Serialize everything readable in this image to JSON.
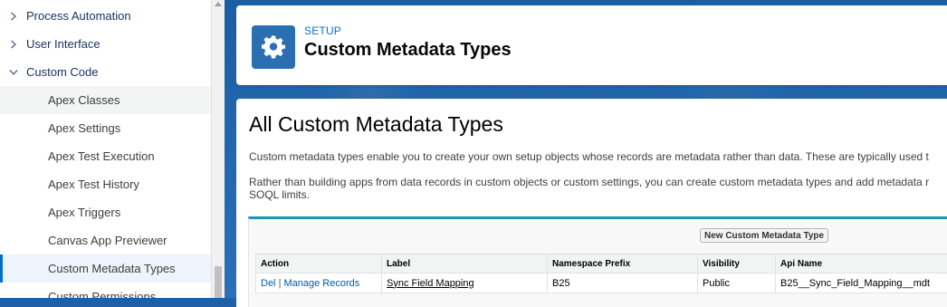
{
  "sidebar": {
    "items": [
      {
        "label": "Process Automation",
        "level": 1,
        "expanded": false
      },
      {
        "label": "User Interface",
        "level": 1,
        "expanded": false
      },
      {
        "label": "Custom Code",
        "level": 1,
        "expanded": true
      },
      {
        "label": "Apex Classes",
        "level": 2
      },
      {
        "label": "Apex Settings",
        "level": 2
      },
      {
        "label": "Apex Test Execution",
        "level": 2
      },
      {
        "label": "Apex Test History",
        "level": 2
      },
      {
        "label": "Apex Triggers",
        "level": 2
      },
      {
        "label": "Canvas App Previewer",
        "level": 2
      },
      {
        "label": "Custom Metadata Types",
        "level": 2,
        "selected": true
      },
      {
        "label": "Custom Permissions",
        "level": 2
      }
    ]
  },
  "header": {
    "eyebrow": "SETUP",
    "title": "Custom Metadata Types",
    "icon": "gear-icon"
  },
  "content": {
    "heading": "All Custom Metadata Types",
    "desc1": "Custom metadata types enable you to create your own setup objects whose records are metadata rather than data. These are typically used t",
    "desc2": "Rather than building apps from data records in custom objects or custom settings, you can create custom metadata types and add metadata r",
    "desc2b": "SOQL limits.",
    "new_button": "New Custom Metadata Type",
    "columns": [
      "Action",
      "Label",
      "Namespace Prefix",
      "Visibility",
      "Api Name"
    ],
    "rows": [
      {
        "action_del": "Del",
        "action_sep": "|",
        "action_manage": "Manage Records",
        "label": "Sync Field Mapping",
        "namespace": "B25",
        "visibility": "Public",
        "api_name": "B25__Sync_Field_Mapping__mdt"
      }
    ]
  },
  "colors": {
    "accent": "#0070d2",
    "header_icon_bg": "#2a6fb1",
    "background": "#1b5ea3",
    "list_border": "#1797c0"
  }
}
